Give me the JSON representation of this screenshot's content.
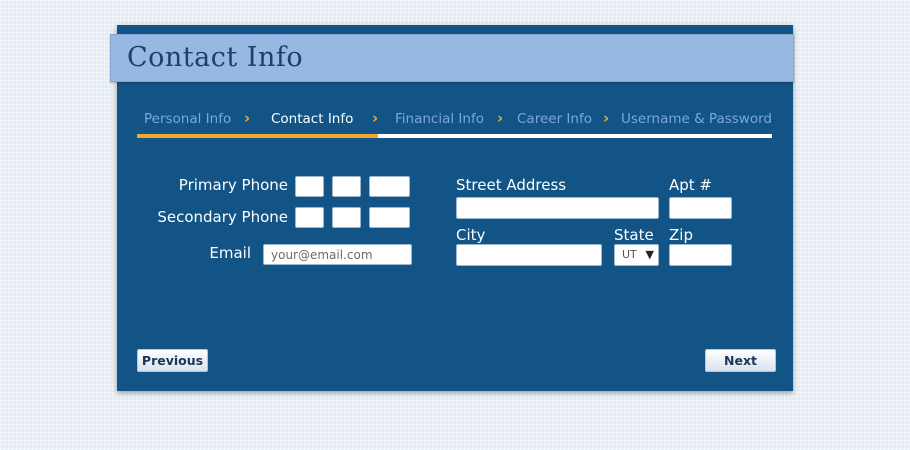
{
  "header": {
    "title": "Contact Info"
  },
  "steps": [
    {
      "label": "Personal Info",
      "active": false
    },
    {
      "label": "Contact Info",
      "active": true
    },
    {
      "label": "Financial Info",
      "active": false
    },
    {
      "label": "Career Info",
      "active": false
    },
    {
      "label": "Username & Password",
      "active": false
    }
  ],
  "step_separator": "›",
  "progress_fraction": 0.38,
  "colors": {
    "panel": "#115485",
    "header_band": "#96b8e2",
    "title_text": "#1f3e6e",
    "accent": "#eea92d",
    "inactive_step": "#7aa8d8"
  },
  "form": {
    "primary_phone_label": "Primary Phone",
    "secondary_phone_label": "Secondary Phone",
    "email_label": "Email",
    "email_placeholder": "your@email.com",
    "street_label": "Street Address",
    "apt_label": "Apt #",
    "city_label": "City",
    "state_label": "State",
    "state_value": "UT",
    "state_arrow": "▼",
    "zip_label": "Zip"
  },
  "buttons": {
    "previous": "Previous",
    "next": "Next"
  }
}
